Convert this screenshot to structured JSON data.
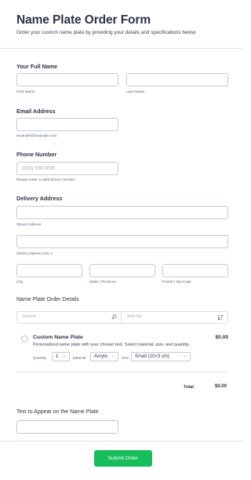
{
  "header": {
    "title": "Name Plate Order Form",
    "subtitle": "Order your custom name plate by providing your details and specifications below."
  },
  "full_name": {
    "label": "Your Full Name",
    "first_sublabel": "First Name",
    "last_sublabel": "Last Name",
    "first_value": "",
    "last_value": ""
  },
  "email": {
    "label": "Email Address",
    "value": "",
    "sublabel": "example@example.com"
  },
  "phone": {
    "label": "Phone Number",
    "placeholder": "(000) 000-0000",
    "sublabel": "Please enter a valid phone number."
  },
  "address": {
    "label": "Delivery Address",
    "street_sublabel": "Street Address",
    "street2_sublabel": "Street Address Line 2",
    "city_sublabel": "City",
    "state_sublabel": "State / Province",
    "postal_sublabel": "Postal / Zip Code"
  },
  "order": {
    "label": "Name Plate Order Details",
    "search_placeholder": "Search",
    "sort_placeholder": "Sort By",
    "product": {
      "name": "Custom Name Plate",
      "price": "$0.00",
      "description": "Personalized name plate with your chosen text. Select material, size, and quantity.",
      "quantity_label": "Quantity",
      "quantity_value": "1",
      "material_label": "Material",
      "material_value": "Acrylic",
      "size_label": "Size",
      "size_value": "Small (10×3 cm)"
    },
    "total_label": "Total",
    "total_value": "$0.00"
  },
  "plate_text": {
    "label": "Text to Appear on the Name Plate",
    "value": ""
  },
  "submit_label": "Submit Order",
  "colors": {
    "accent": "#18bd5b",
    "text": "#2c3345",
    "border": "#c3cad8"
  }
}
